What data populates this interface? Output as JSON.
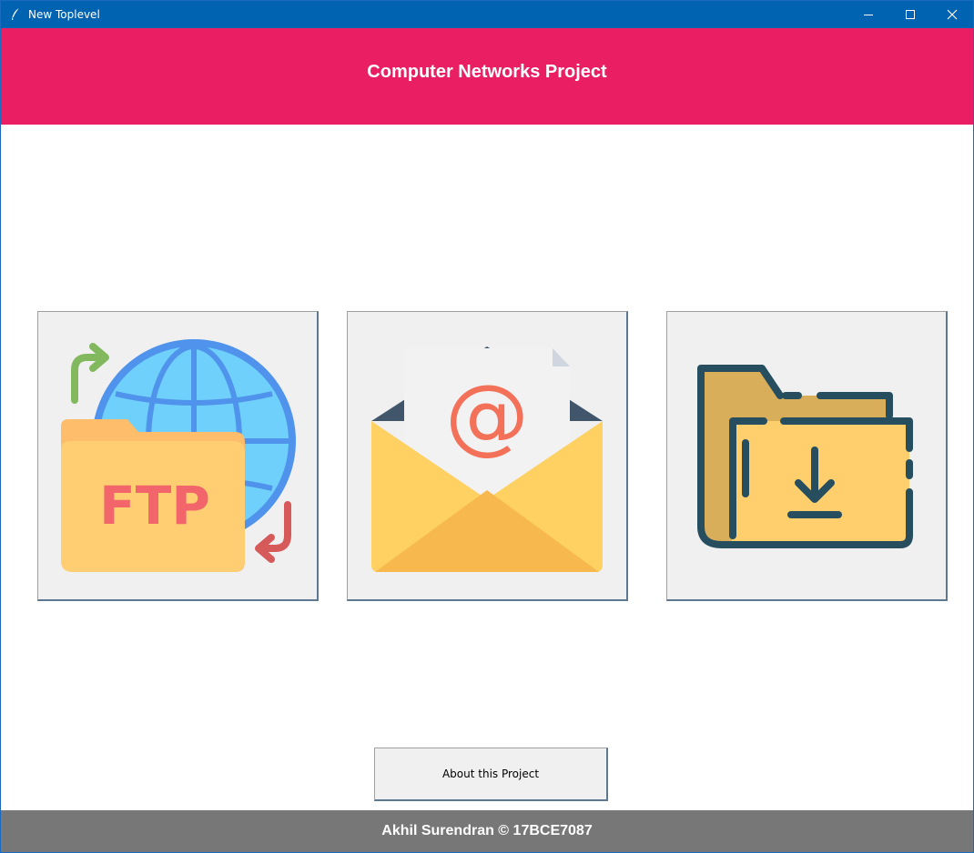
{
  "window": {
    "title": "New Toplevel",
    "icon": "feather-icon",
    "controls": [
      "minimize-icon",
      "maximize-icon",
      "close-icon"
    ]
  },
  "header": {
    "title": "Computer Networks Project",
    "background": "#e91e63"
  },
  "tiles": [
    {
      "name": "ftp",
      "icon": "ftp-folder-globe-icon",
      "label": "FTP"
    },
    {
      "name": "mail",
      "icon": "email-envelope-icon",
      "label": "@"
    },
    {
      "name": "download",
      "icon": "folder-download-icon"
    }
  ],
  "about_button": {
    "label": "About this Project"
  },
  "footer": {
    "text": "Akhil Surendran © 17BCE7087",
    "background": "#777777"
  },
  "colors": {
    "titlebar": "#0063b1",
    "tile_bg": "#f0f0f0"
  }
}
